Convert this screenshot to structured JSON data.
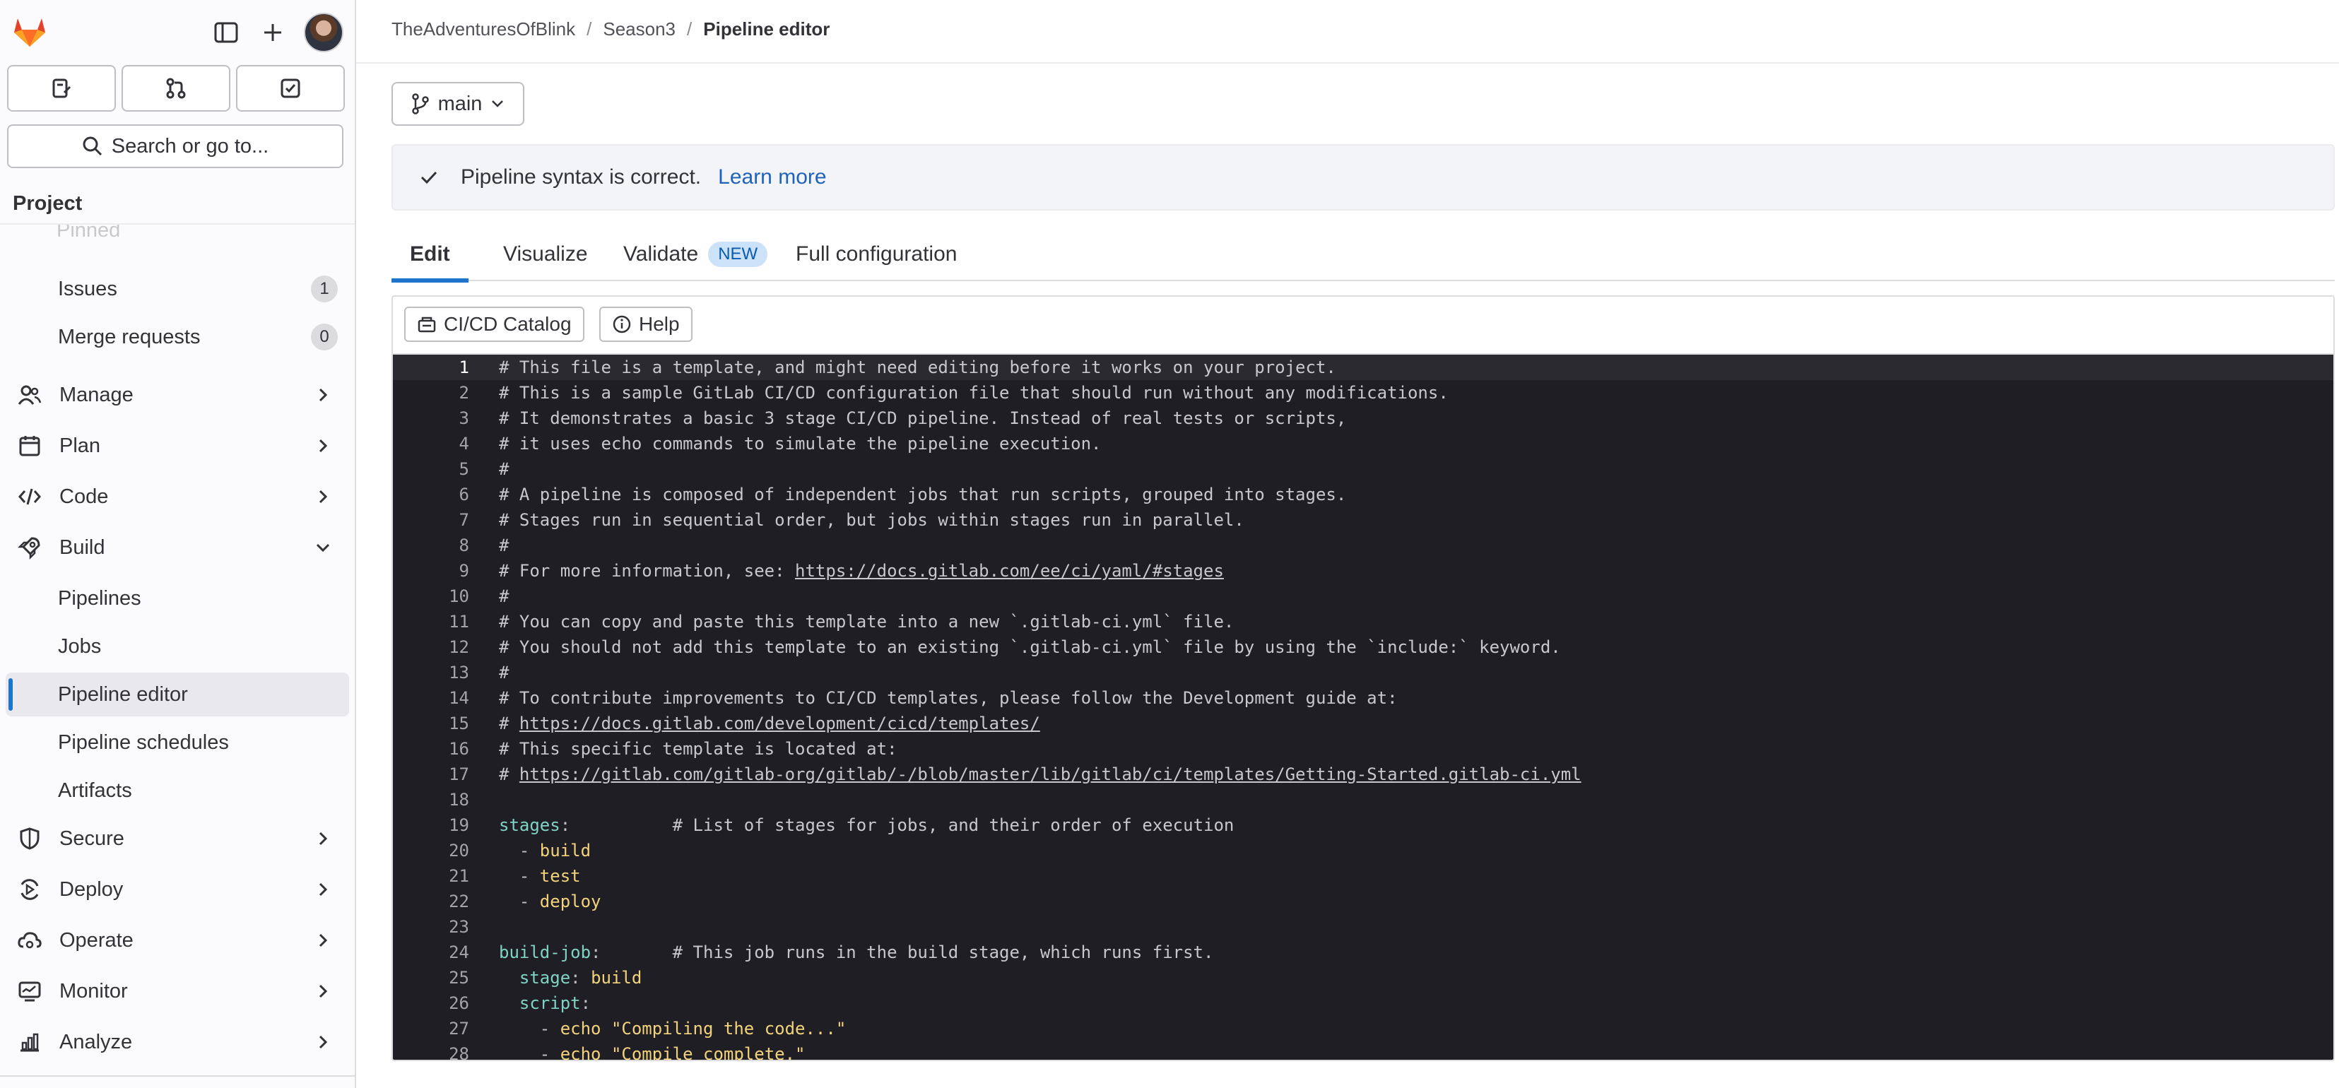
{
  "sidebar": {
    "search_label": "Search or go to...",
    "section_title": "Project",
    "pinned_label": "Pinned",
    "items": [
      {
        "label": "Issues",
        "count": "1"
      },
      {
        "label": "Merge requests",
        "count": "0"
      },
      {
        "label": "Manage"
      },
      {
        "label": "Plan"
      },
      {
        "label": "Code"
      },
      {
        "label": "Build"
      },
      {
        "label": "Pipelines"
      },
      {
        "label": "Jobs"
      },
      {
        "label": "Pipeline editor"
      },
      {
        "label": "Pipeline schedules"
      },
      {
        "label": "Artifacts"
      },
      {
        "label": "Secure"
      },
      {
        "label": "Deploy"
      },
      {
        "label": "Operate"
      },
      {
        "label": "Monitor"
      },
      {
        "label": "Analyze"
      }
    ]
  },
  "breadcrumb": {
    "group": "TheAdventuresOfBlink",
    "project": "Season3",
    "current": "Pipeline editor",
    "separator": "/"
  },
  "branch": {
    "name": "main"
  },
  "alert": {
    "message": "Pipeline syntax is correct.",
    "link": "Learn more"
  },
  "tabs": [
    {
      "label": "Edit"
    },
    {
      "label": "Visualize"
    },
    {
      "label": "Validate",
      "badge": "NEW"
    },
    {
      "label": "Full configuration"
    }
  ],
  "toolbar": {
    "catalog_label": "CI/CD Catalog",
    "help_label": "Help"
  },
  "colors": {
    "accent": "#1f75cb",
    "link": "#1f63b8",
    "editor_bg": "#1f1e24"
  },
  "editor": {
    "lines": [
      {
        "n": "1",
        "parts": [
          {
            "t": "# This file is a template, and might need editing before it works on your project.",
            "c": "comment"
          }
        ]
      },
      {
        "n": "2",
        "parts": [
          {
            "t": "# This is a sample GitLab CI/CD configuration file that should run without any modifications.",
            "c": "comment"
          }
        ]
      },
      {
        "n": "3",
        "parts": [
          {
            "t": "# It demonstrates a basic 3 stage CI/CD pipeline. Instead of real tests or scripts,",
            "c": "comment"
          }
        ]
      },
      {
        "n": "4",
        "parts": [
          {
            "t": "# it uses echo commands to simulate the pipeline execution.",
            "c": "comment"
          }
        ]
      },
      {
        "n": "5",
        "parts": [
          {
            "t": "#",
            "c": "comment"
          }
        ]
      },
      {
        "n": "6",
        "parts": [
          {
            "t": "# A pipeline is composed of independent jobs that run scripts, grouped into stages.",
            "c": "comment"
          }
        ]
      },
      {
        "n": "7",
        "parts": [
          {
            "t": "# Stages run in sequential order, but jobs within stages run in parallel.",
            "c": "comment"
          }
        ]
      },
      {
        "n": "8",
        "parts": [
          {
            "t": "#",
            "c": "comment"
          }
        ]
      },
      {
        "n": "9",
        "parts": [
          {
            "t": "# For more information, see: ",
            "c": "comment"
          },
          {
            "t": "https://docs.gitlab.com/ee/ci/yaml/#stages",
            "c": "link"
          }
        ]
      },
      {
        "n": "10",
        "parts": [
          {
            "t": "#",
            "c": "comment"
          }
        ]
      },
      {
        "n": "11",
        "parts": [
          {
            "t": "# You can copy and paste this template into a new `.gitlab-ci.yml` file.",
            "c": "comment"
          }
        ]
      },
      {
        "n": "12",
        "parts": [
          {
            "t": "# You should not add this template to an existing `.gitlab-ci.yml` file by using the `include:` keyword.",
            "c": "comment"
          }
        ]
      },
      {
        "n": "13",
        "parts": [
          {
            "t": "#",
            "c": "comment"
          }
        ]
      },
      {
        "n": "14",
        "parts": [
          {
            "t": "# To contribute improvements to CI/CD templates, please follow the Development guide at:",
            "c": "comment"
          }
        ]
      },
      {
        "n": "15",
        "parts": [
          {
            "t": "# ",
            "c": "comment"
          },
          {
            "t": "https://docs.gitlab.com/development/cicd/templates/",
            "c": "link"
          }
        ]
      },
      {
        "n": "16",
        "parts": [
          {
            "t": "# This specific template is located at:",
            "c": "comment"
          }
        ]
      },
      {
        "n": "17",
        "parts": [
          {
            "t": "# ",
            "c": "comment"
          },
          {
            "t": "https://gitlab.com/gitlab-org/gitlab/-/blob/master/lib/gitlab/ci/templates/Getting-Started.gitlab-ci.yml",
            "c": "link"
          }
        ]
      },
      {
        "n": "18",
        "parts": []
      },
      {
        "n": "19",
        "parts": [
          {
            "t": "stages",
            "c": "key"
          },
          {
            "t": ":          ",
            "c": "dash"
          },
          {
            "t": "# List of stages for jobs, and their order of execution",
            "c": "comment"
          }
        ]
      },
      {
        "n": "20",
        "parts": [
          {
            "t": "  - ",
            "c": "dash"
          },
          {
            "t": "build",
            "c": "val"
          }
        ]
      },
      {
        "n": "21",
        "parts": [
          {
            "t": "  - ",
            "c": "dash"
          },
          {
            "t": "test",
            "c": "val"
          }
        ]
      },
      {
        "n": "22",
        "parts": [
          {
            "t": "  - ",
            "c": "dash"
          },
          {
            "t": "deploy",
            "c": "val"
          }
        ]
      },
      {
        "n": "23",
        "parts": []
      },
      {
        "n": "24",
        "parts": [
          {
            "t": "build-job",
            "c": "key"
          },
          {
            "t": ":       ",
            "c": "dash"
          },
          {
            "t": "# This job runs in the build stage, which runs first.",
            "c": "comment"
          }
        ]
      },
      {
        "n": "25",
        "parts": [
          {
            "t": "  ",
            "c": "dash"
          },
          {
            "t": "stage",
            "c": "key"
          },
          {
            "t": ": ",
            "c": "dash"
          },
          {
            "t": "build",
            "c": "val"
          }
        ]
      },
      {
        "n": "26",
        "parts": [
          {
            "t": "  ",
            "c": "dash"
          },
          {
            "t": "script",
            "c": "key"
          },
          {
            "t": ":",
            "c": "dash"
          }
        ]
      },
      {
        "n": "27",
        "parts": [
          {
            "t": "    - ",
            "c": "dash"
          },
          {
            "t": "echo \"Compiling the code...\"",
            "c": "val"
          }
        ]
      },
      {
        "n": "28",
        "parts": [
          {
            "t": "    - ",
            "c": "dash"
          },
          {
            "t": "echo \"Compile complete.\"",
            "c": "val"
          }
        ]
      }
    ]
  }
}
